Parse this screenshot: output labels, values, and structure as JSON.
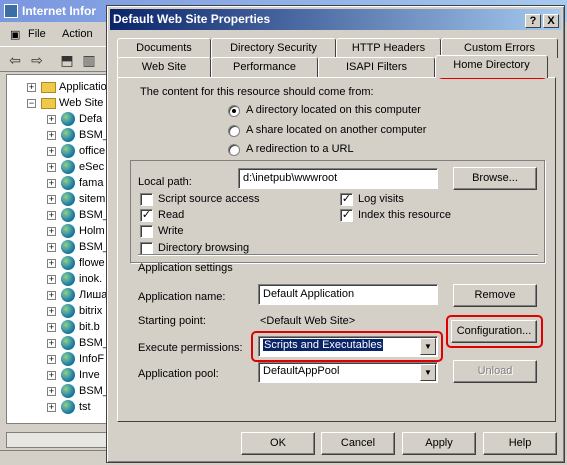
{
  "background_window": {
    "title": "Internet Infor",
    "menu": [
      "File",
      "Action"
    ],
    "tree_items": [
      "Applicatio",
      "Web Site",
      "Defa",
      "BSM_",
      "office",
      "eSec",
      "fama",
      "sitem",
      "BSM_",
      "Holm",
      "BSM_",
      "flowe",
      "inok.",
      "Лиша",
      "bitrix",
      "bit.b",
      "BSM_",
      "InfoF",
      "Inve",
      "BSM_",
      "tst"
    ]
  },
  "dialog": {
    "title": "Default Web Site Properties",
    "caption_help": "?",
    "caption_close": "X",
    "tabs_row1": [
      "Documents",
      "Directory Security",
      "HTTP Headers",
      "Custom Errors"
    ],
    "tabs_row2": [
      "Web Site",
      "Performance",
      "ISAPI Filters",
      "Home Directory"
    ],
    "active_tab": "Home Directory",
    "content_source_label": "The content for this resource should come from:",
    "source_options": [
      {
        "label": "A directory located on this computer",
        "selected": true
      },
      {
        "label": "A share located on another computer",
        "selected": false
      },
      {
        "label": "A redirection to a URL",
        "selected": false
      }
    ],
    "local_path_label": "Local path:",
    "local_path_value": "d:\\inetpub\\wwwroot",
    "browse_button": "Browse...",
    "permissions": [
      {
        "label": "Script source access",
        "checked": false
      },
      {
        "label": "Read",
        "checked": true
      },
      {
        "label": "Write",
        "checked": false
      },
      {
        "label": "Directory browsing",
        "checked": false
      }
    ],
    "logging": [
      {
        "label": "Log visits",
        "checked": true
      },
      {
        "label": "Index this resource",
        "checked": true
      }
    ],
    "app_settings_heading": "Application settings",
    "app_name_label": "Application name:",
    "app_name_value": "Default Application",
    "remove_button": "Remove",
    "starting_point_label": "Starting point:",
    "starting_point_value": "<Default Web Site>",
    "configuration_button": "Configuration...",
    "execute_permissions_label": "Execute permissions:",
    "execute_permissions_value": "Scripts and Executables",
    "app_pool_label": "Application pool:",
    "app_pool_value": "DefaultAppPool",
    "unload_button": "Unload",
    "ok_button": "OK",
    "cancel_button": "Cancel",
    "apply_button": "Apply",
    "help_button": "Help"
  },
  "colors": {
    "highlight_box": "#e00000",
    "title_active": "#0a246a",
    "face": "#d4d0c8"
  }
}
